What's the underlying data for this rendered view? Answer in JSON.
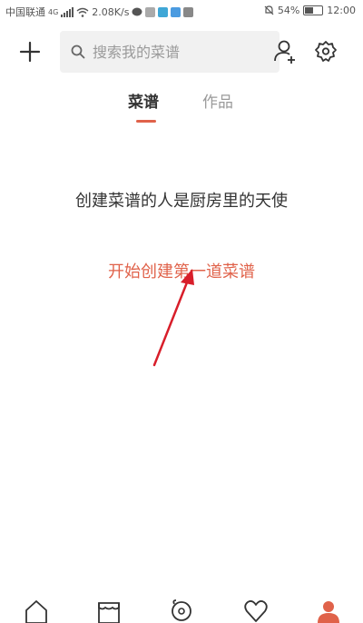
{
  "status_bar": {
    "carrier": "中国联通",
    "network": "4G",
    "speed": "2.08K/s",
    "battery": "54%",
    "battery_level": 0.54,
    "time": "12:00"
  },
  "search": {
    "placeholder": "搜索我的菜谱"
  },
  "tabs": [
    {
      "label": "菜谱",
      "active": true
    },
    {
      "label": "作品",
      "active": false
    }
  ],
  "empty_state": {
    "message": "创建菜谱的人是厨房里的天使",
    "action_label": "开始创建第一道菜谱"
  },
  "bottom_nav": [
    "home-icon",
    "market-icon",
    "community-icon",
    "favorites-icon",
    "profile-icon"
  ],
  "colors": {
    "accent": "#e0624a",
    "annotation_arrow": "#d81e2a"
  }
}
